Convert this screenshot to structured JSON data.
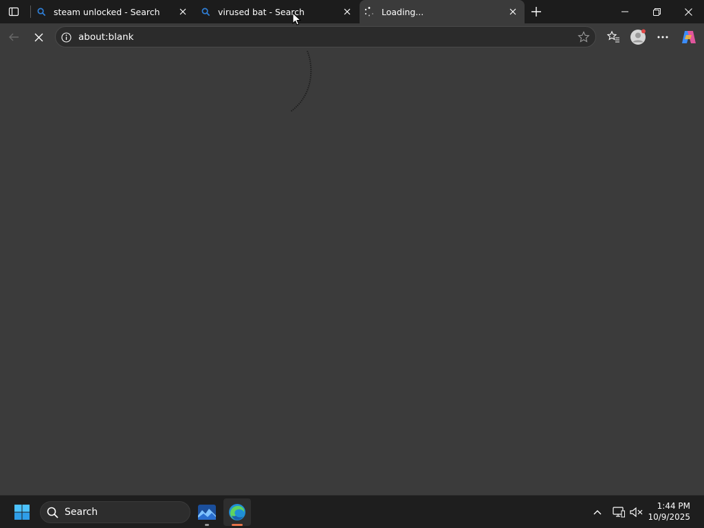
{
  "browser": {
    "tabs": [
      {
        "title": "steam unlocked - Search",
        "favicon": "search-icon",
        "active": false
      },
      {
        "title": "virused bat - Search",
        "favicon": "search-icon",
        "active": false
      },
      {
        "title": "Loading...",
        "favicon": "loading-spinner-icon",
        "active": true
      }
    ],
    "address": {
      "url": "about:blank"
    }
  },
  "taskbar": {
    "search_label": "Search",
    "clock": {
      "time": "1:44 PM",
      "date": "10/9/2025"
    }
  },
  "colors": {
    "page_bg": "#3b3b3b",
    "tabstrip_bg": "#1c1c1c",
    "accent_blue": "#2f7fd8",
    "edge_indicator": "#e8734a"
  }
}
